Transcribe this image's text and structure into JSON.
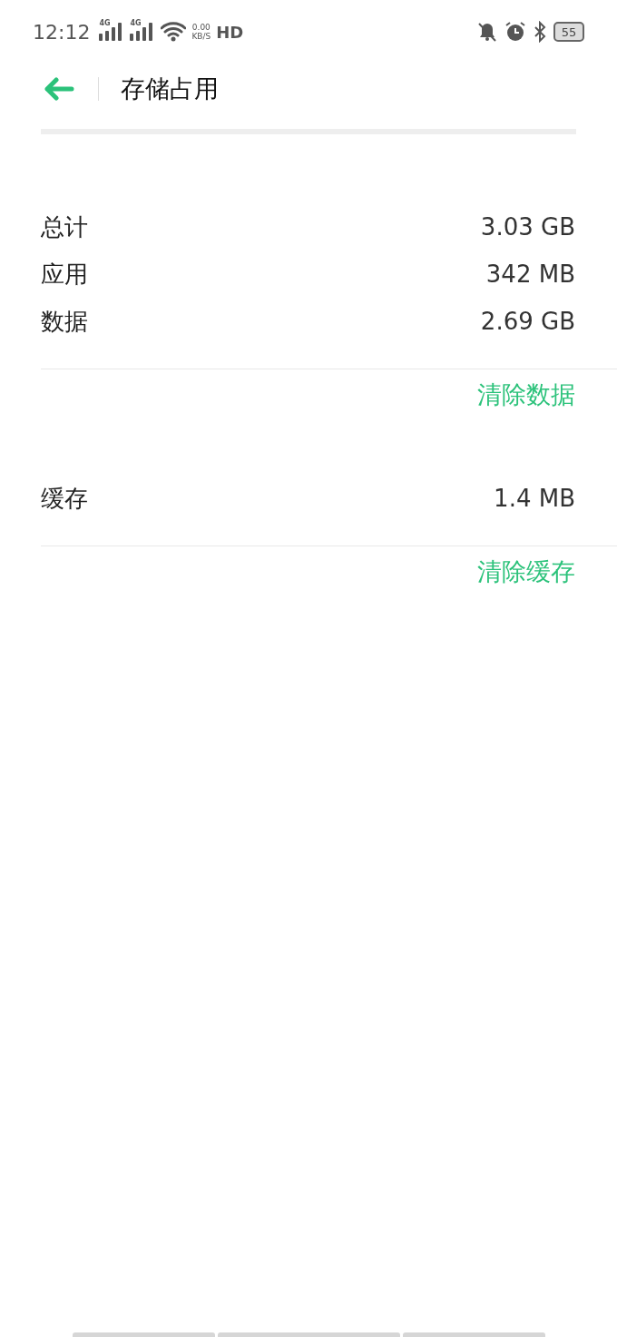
{
  "status_bar": {
    "time": "12:12",
    "network": [
      "4G",
      "4G"
    ],
    "speed_value": "0.00",
    "speed_unit": "KB/S",
    "hd": "HD",
    "battery": "55"
  },
  "header": {
    "title": "存储占用"
  },
  "sections": [
    {
      "rows": [
        {
          "label": "总计",
          "value": "3.03 GB"
        },
        {
          "label": "应用",
          "value": "342 MB"
        },
        {
          "label": "数据",
          "value": "2.69 GB"
        }
      ],
      "action": "清除数据"
    },
    {
      "rows": [
        {
          "label": "缓存",
          "value": "1.4 MB"
        }
      ],
      "action": "清除缓存"
    }
  ]
}
